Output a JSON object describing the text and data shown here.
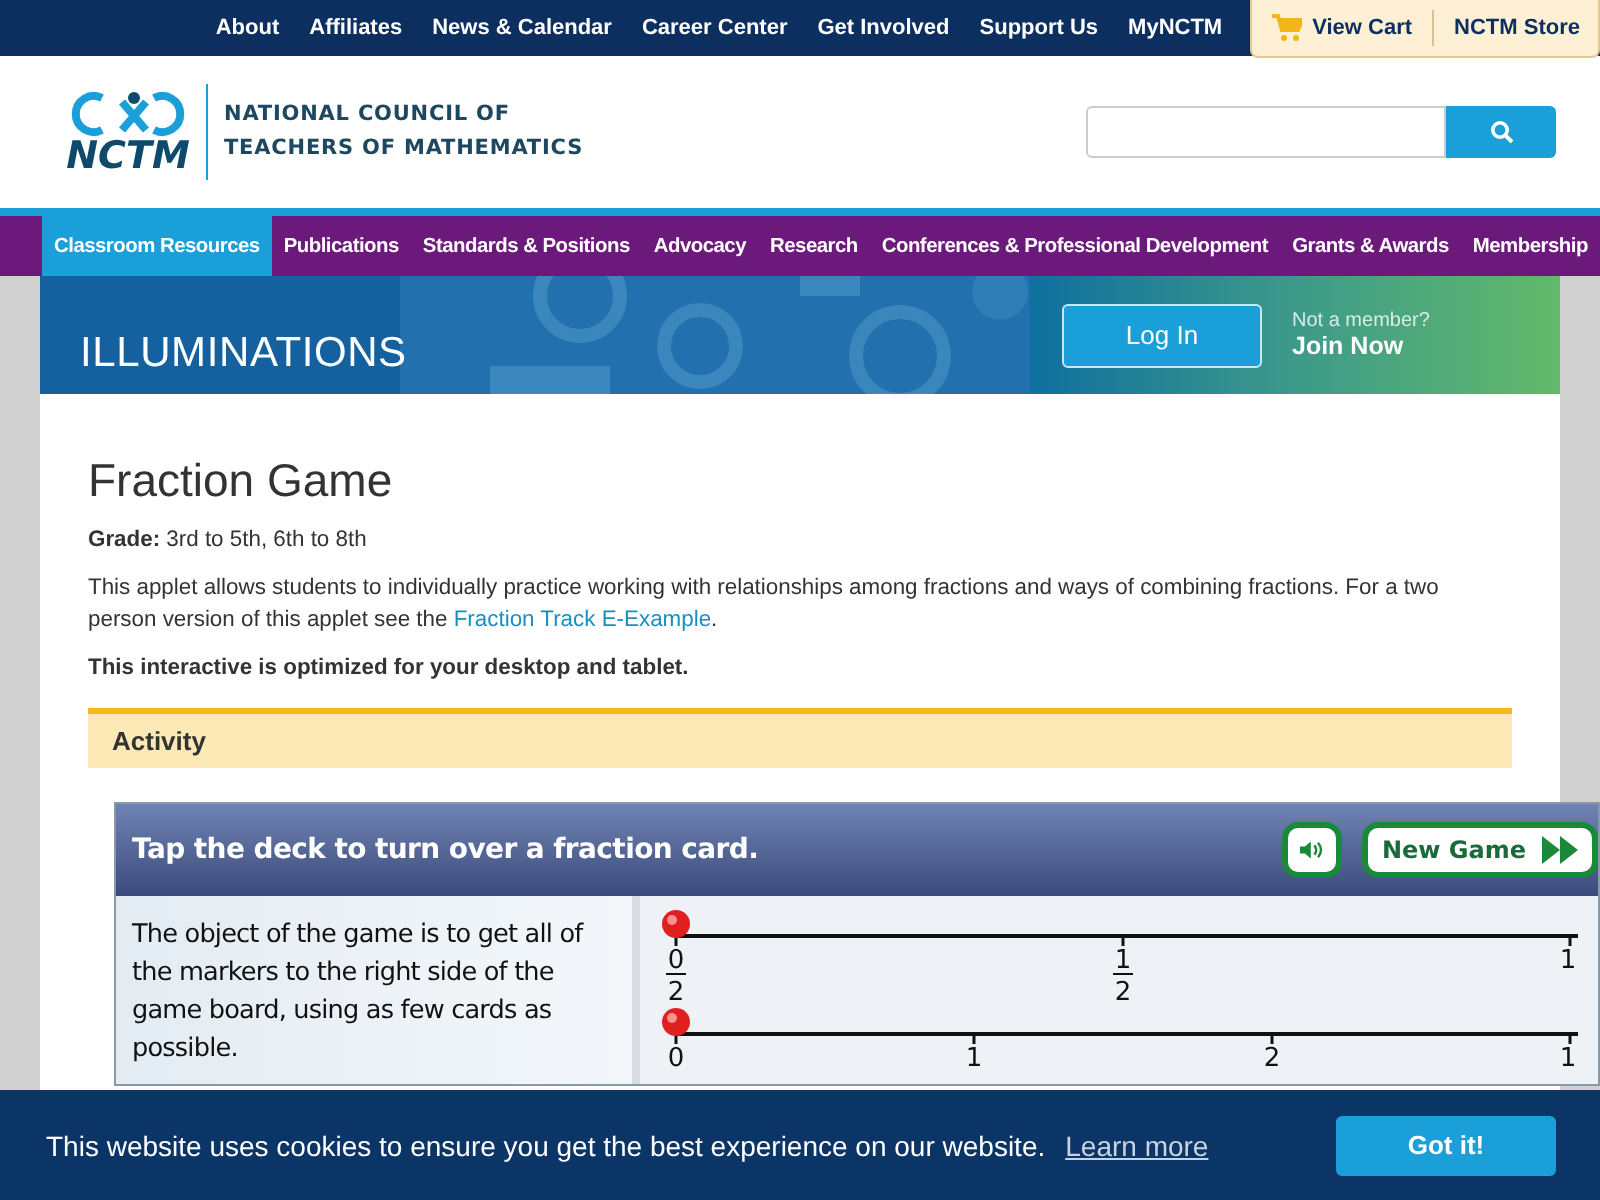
{
  "top_bar": {
    "links": [
      "About",
      "Affiliates",
      "News & Calendar",
      "Career Center",
      "Get Involved",
      "Support Us",
      "MyNCTM"
    ],
    "cart": "View Cart",
    "store": "NCTM Store"
  },
  "header": {
    "logo_text": "NCTM",
    "org_name": [
      "NATIONAL COUNCIL OF",
      "TEACHERS OF MATHEMATICS"
    ]
  },
  "nav": [
    {
      "label": "Classroom Resources",
      "selected": true
    },
    {
      "label": "Publications",
      "selected": false
    },
    {
      "label": "Standards & Positions",
      "selected": false
    },
    {
      "label": "Advocacy",
      "selected": false
    },
    {
      "label": "Research",
      "selected": false
    },
    {
      "label": "Conferences & Professional Development",
      "selected": false
    },
    {
      "label": "Grants & Awards",
      "selected": false
    },
    {
      "label": "Membership",
      "selected": false
    }
  ],
  "banner": {
    "title": "ILLUMINATIONS",
    "login": "Log In",
    "member_prompt": "Not a member?",
    "join": "Join Now"
  },
  "page": {
    "title": "Fraction Game",
    "grade_label": "Grade:",
    "grade": "3rd to 5th, 6th to 8th",
    "description": "This applet allows students to individually practice working with relationships among fractions and ways of combining fractions. For a two person version of this applet see the ",
    "link": "Fraction Track E-Example",
    "description_end": ".",
    "note": "This interactive is optimized for your desktop and tablet.",
    "section": "Activity"
  },
  "game": {
    "instruction": "Tap the deck to turn over a fraction card.",
    "new_game": "New Game",
    "sound_on": true,
    "objective": "The object of the game is to get all of the markers to the right side of the game board, using as few cards as possible.",
    "number_lines": [
      {
        "level": 0,
        "ticks": [
          {
            "num": "0",
            "den": "2"
          },
          {
            "num": "1",
            "den": "2"
          },
          {
            "num": "1"
          }
        ]
      },
      {
        "level": 0,
        "ticks": [
          {
            "num": "0"
          },
          {
            "num": "1"
          },
          {
            "num": "2"
          },
          {
            "num": "1"
          }
        ]
      }
    ]
  },
  "cookie": {
    "message": "This website uses cookies to ensure you get the best experience on our website.",
    "learn_more": "Learn more",
    "accept": "Got it!"
  }
}
